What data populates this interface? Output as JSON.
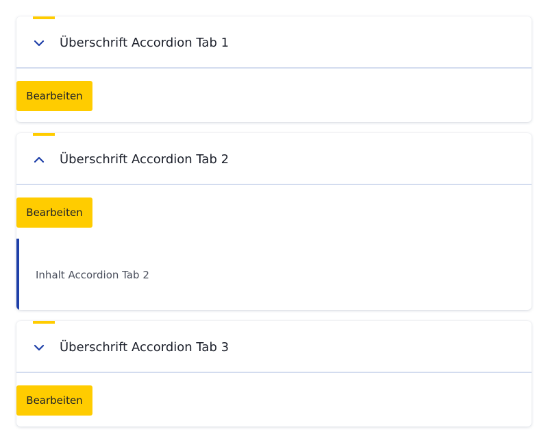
{
  "colors": {
    "accent_yellow": "#ffcc00",
    "accent_blue": "#1e3fa8",
    "divider": "#d3dcef",
    "text_primary": "#1b1f2a",
    "text_secondary": "#4a4f5c"
  },
  "accordion": {
    "tabs": [
      {
        "title": "Überschrift Accordion Tab 1",
        "expanded": false,
        "toggle_icon": "chevron-down-icon",
        "edit_label": "Bearbeiten"
      },
      {
        "title": "Überschrift Accordion Tab 2",
        "expanded": true,
        "toggle_icon": "chevron-up-icon",
        "edit_label": "Bearbeiten",
        "content": "Inhalt Accordion Tab 2"
      },
      {
        "title": "Überschrift Accordion Tab 3",
        "expanded": false,
        "toggle_icon": "chevron-down-icon",
        "edit_label": "Bearbeiten"
      }
    ]
  }
}
